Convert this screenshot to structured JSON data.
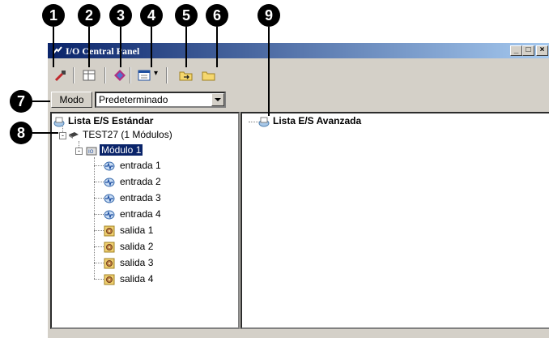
{
  "callouts": [
    "1",
    "2",
    "3",
    "4",
    "5",
    "6",
    "7",
    "8",
    "9"
  ],
  "window": {
    "title": "I/O Central Panel",
    "min_glyph": "_",
    "max_glyph": "□",
    "close_glyph": "×"
  },
  "toolbar": {
    "buttons": [
      "wrench-icon",
      "table-icon",
      "diamond-icon",
      "panel-dropdown-icon",
      "folder-arrow-icon",
      "folder-icon"
    ],
    "dropdown_glyph": "▾"
  },
  "mode": {
    "label": "Modo",
    "selected": "Predeterminado"
  },
  "left_tree": {
    "root": "Lista E/S Estándar",
    "device": "TEST27 (1 Módulos)",
    "module": "Módulo 1",
    "items": [
      "entrada 1",
      "entrada 2",
      "entrada 3",
      "entrada 4",
      "salida 1",
      "salida 2",
      "salida 3",
      "salida 4"
    ]
  },
  "right_tree": {
    "root": "Lista E/S Avanzada"
  },
  "colors": {
    "titlebar_start": "#0a246a",
    "titlebar_end": "#a6caf0",
    "selection": "#0a246a",
    "chrome": "#d4d0c8"
  }
}
